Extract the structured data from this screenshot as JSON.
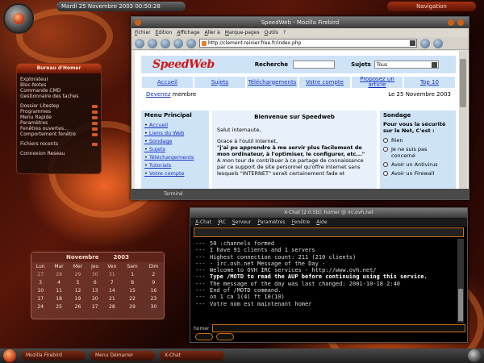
{
  "topbar": {
    "clock": "Mardi 25 Novembre 2003  00:50:28",
    "nav": "Navigation"
  },
  "bureau": {
    "title": "Bureau d'Homer",
    "items": [
      "Explorateur",
      "Bloc-Notes",
      "Commande CMD",
      "Gestionnaire des taches"
    ],
    "items2": [
      "Dossier Litestep",
      "Programmes",
      "Menu Rapide",
      "Paramètres",
      "Fenêtres ouvertes...",
      "Comportement fenêtre"
    ],
    "items3": [
      "Fichiers recents"
    ],
    "items4": [
      "Connexion Reseau"
    ]
  },
  "calendar": {
    "month": "Novembre",
    "year": "2003",
    "weekdays": [
      "Lun",
      "Mar",
      "Mer",
      "Jeu",
      "Ven",
      "Sam",
      "Dim"
    ],
    "weeks": [
      [
        "27",
        "28",
        "29",
        "30",
        "31",
        "1",
        "2"
      ],
      [
        "3",
        "4",
        "5",
        "6",
        "7",
        "8",
        "9"
      ],
      [
        "10",
        "11",
        "12",
        "13",
        "14",
        "15",
        "16"
      ],
      [
        "17",
        "18",
        "19",
        "20",
        "21",
        "22",
        "23"
      ],
      [
        "24",
        "25",
        "26",
        "27",
        "28",
        "29",
        "30"
      ]
    ]
  },
  "firefox": {
    "title": "SpeedWeb - Mozilla Firebird",
    "menu": [
      "Fichier",
      "Edition",
      "Affichage",
      "Aller à",
      "Marque-pages",
      "Outils",
      "?"
    ],
    "url": "http://clement.reinier.free.fr/index.php",
    "status": "Terminé"
  },
  "speedweb": {
    "logo": "SpeedWeb",
    "search_label": "Recherche",
    "subjects_label": "Sujets",
    "subjects_value": "Tous",
    "nav": [
      "Accueil",
      "Sujets",
      "Téléchargements",
      "Votre compte",
      "Proposez un article",
      "Top 10"
    ],
    "become_link": "Devenez",
    "become_text": " membre",
    "date": "Le 25 Novembre 2003",
    "menu_title": "Menu Principal",
    "menu_items": [
      "Accueil",
      "Liens du Web",
      "Sondage",
      "Sujets",
      "Téléchargements",
      "Tutorials",
      "Votre compte"
    ],
    "welcome_title": "Bienvenue sur Speedweb",
    "greeting": "Salut internaute,",
    "intro_lead": "Grace à l'outil Internet,",
    "intro_bold": "\"j'ai pu apprendre à me servir plus facilement de mon ordinateur, à l'optimiser, le configurer, etc...\"",
    "intro_rest": "A mon tour de contribuer à ce partage de connaissance par ce support de site personnel qu'offre Internet sans lesquels \"INTERNET\" serait certainement fade et",
    "poll_title": "Sondage",
    "poll_question": "Pour vous la sécurité sur le Net, C'est :",
    "poll_options": [
      "Rien",
      "Je ne suis pas concerné",
      "Avoir un Antivirus",
      "Avoir un Firewall"
    ]
  },
  "xchat": {
    "title": "X-Chat [2.0.5b]: homer @ irc.ovh.net",
    "menu": [
      "X-Chat",
      "IRC",
      "Serveur",
      "Paramètres",
      "Fenêtre",
      "Aide"
    ],
    "log": [
      {
        "pre": "---",
        "text": "50 :channels formed",
        "bold": false
      },
      {
        "pre": "---",
        "text": "I have 91 clients and 1 servers",
        "bold": false
      },
      {
        "pre": "---",
        "text": "Highest connection count: 211 (210 clients)",
        "bold": false
      },
      {
        "pre": "---",
        "text": "- irc.ovh.net Message of the Day -",
        "bold": false
      },
      {
        "pre": "---",
        "text": "Welcome to OVH IRC services - http://www.ovh.net/",
        "bold": false
      },
      {
        "pre": "---",
        "text": "Type /MOTD to read the AUP before continuing using this service.",
        "bold": true
      },
      {
        "pre": "---",
        "text": "The message of the day was last changed: 2001-10-18 2:40",
        "bold": false
      },
      {
        "pre": "---",
        "text": "End of /MOTD command.",
        "bold": false
      },
      {
        "pre": "---",
        "text": "on 1 ca 1(4) ft 10(10)",
        "bold": false
      },
      {
        "pre": "---",
        "text": "Votre nom est maintenant homer",
        "bold": false
      }
    ],
    "nick": "homer"
  },
  "taskbar": {
    "tasks": [
      "Mozilla Firebird",
      "Menu Démarrer",
      "X-Chat"
    ]
  }
}
